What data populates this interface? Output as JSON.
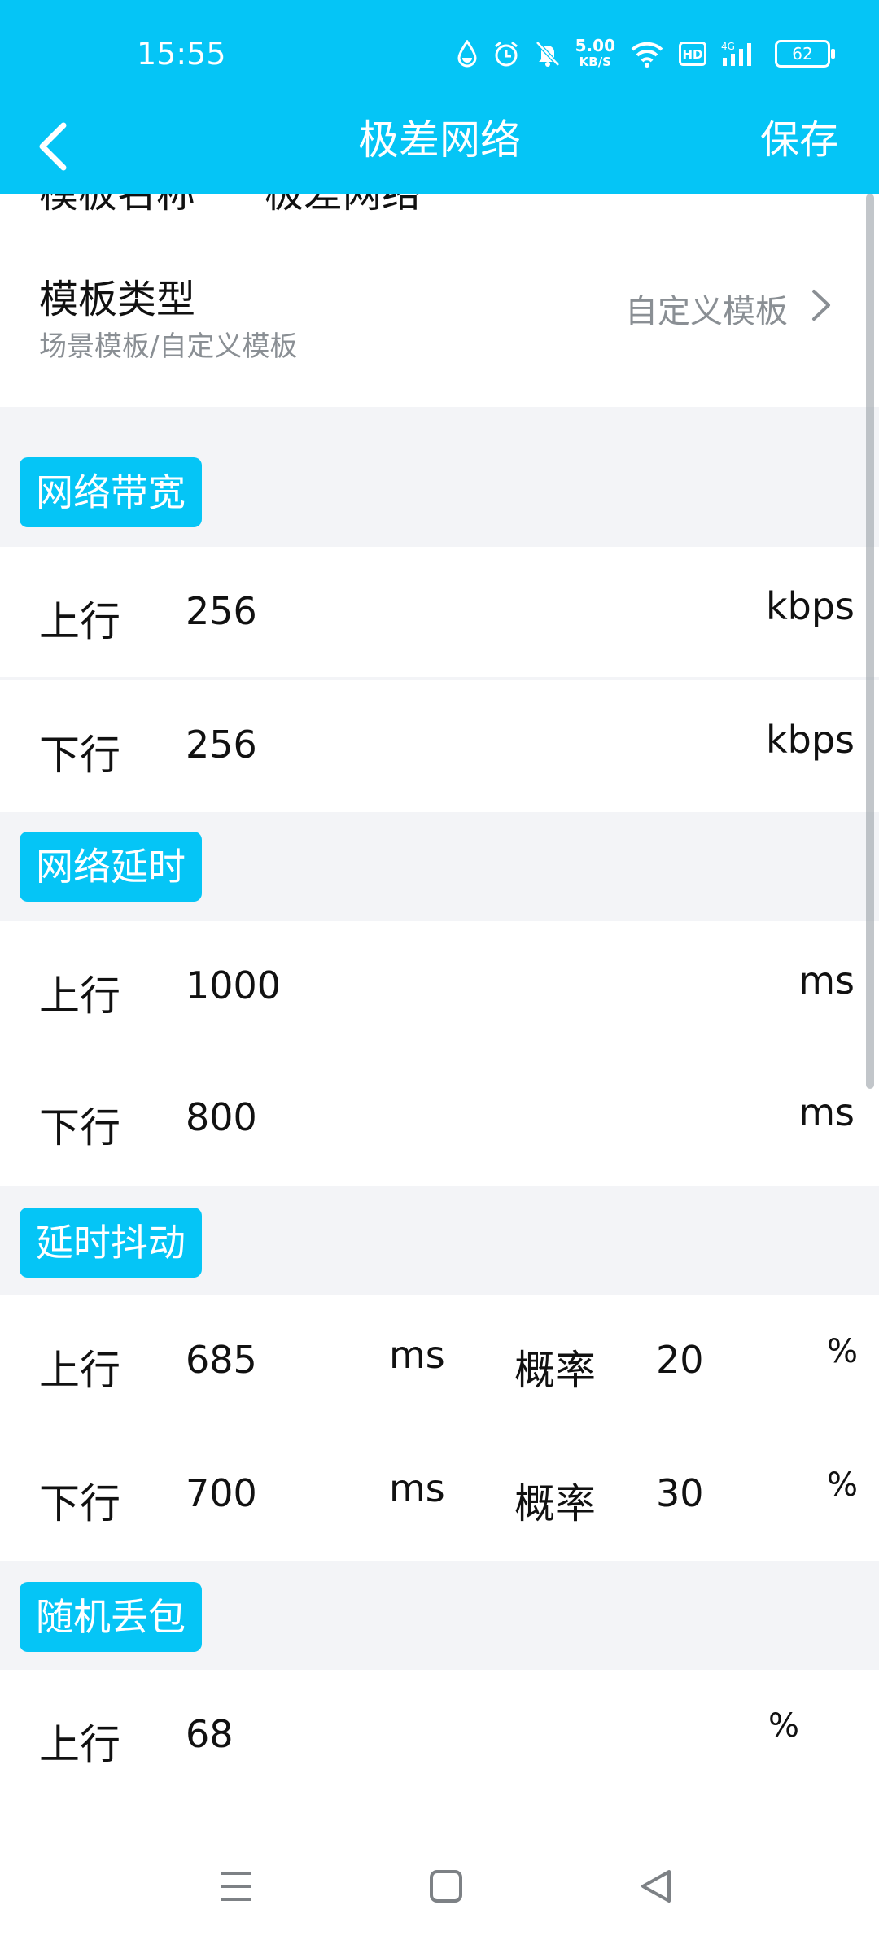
{
  "status": {
    "time": "15:55",
    "speed_value": "5.00",
    "speed_unit": "KB/S",
    "battery": "62"
  },
  "appbar": {
    "title": "极差网络",
    "save_label": "保存"
  },
  "template": {
    "name_label": "模板名称",
    "name_value": "极差网络",
    "type_label": "模板类型",
    "type_sub": "场景模板/自定义模板",
    "type_value": "自定义模板"
  },
  "sections": {
    "bandwidth": {
      "title": "网络带宽",
      "up": {
        "label": "上行",
        "value": "256",
        "unit": "kbps"
      },
      "down": {
        "label": "下行",
        "value": "256",
        "unit": "kbps"
      }
    },
    "latency": {
      "title": "网络延时",
      "up": {
        "label": "上行",
        "value": "1000",
        "unit": "ms"
      },
      "down": {
        "label": "下行",
        "value": "800",
        "unit": "ms"
      }
    },
    "jitter": {
      "title": "延时抖动",
      "up": {
        "label": "上行",
        "value": "685",
        "unit": "ms",
        "prob_label": "概率",
        "prob_value": "20",
        "prob_unit": "%"
      },
      "down": {
        "label": "下行",
        "value": "700",
        "unit": "ms",
        "prob_label": "概率",
        "prob_value": "30",
        "prob_unit": "%"
      }
    },
    "packet_loss": {
      "title": "随机丢包",
      "up": {
        "label": "上行",
        "value": "68",
        "unit": "%"
      }
    }
  },
  "colors": {
    "accent": "#05c5f6",
    "section_bg": "#f3f4f7",
    "muted_text": "#8a8f94"
  }
}
